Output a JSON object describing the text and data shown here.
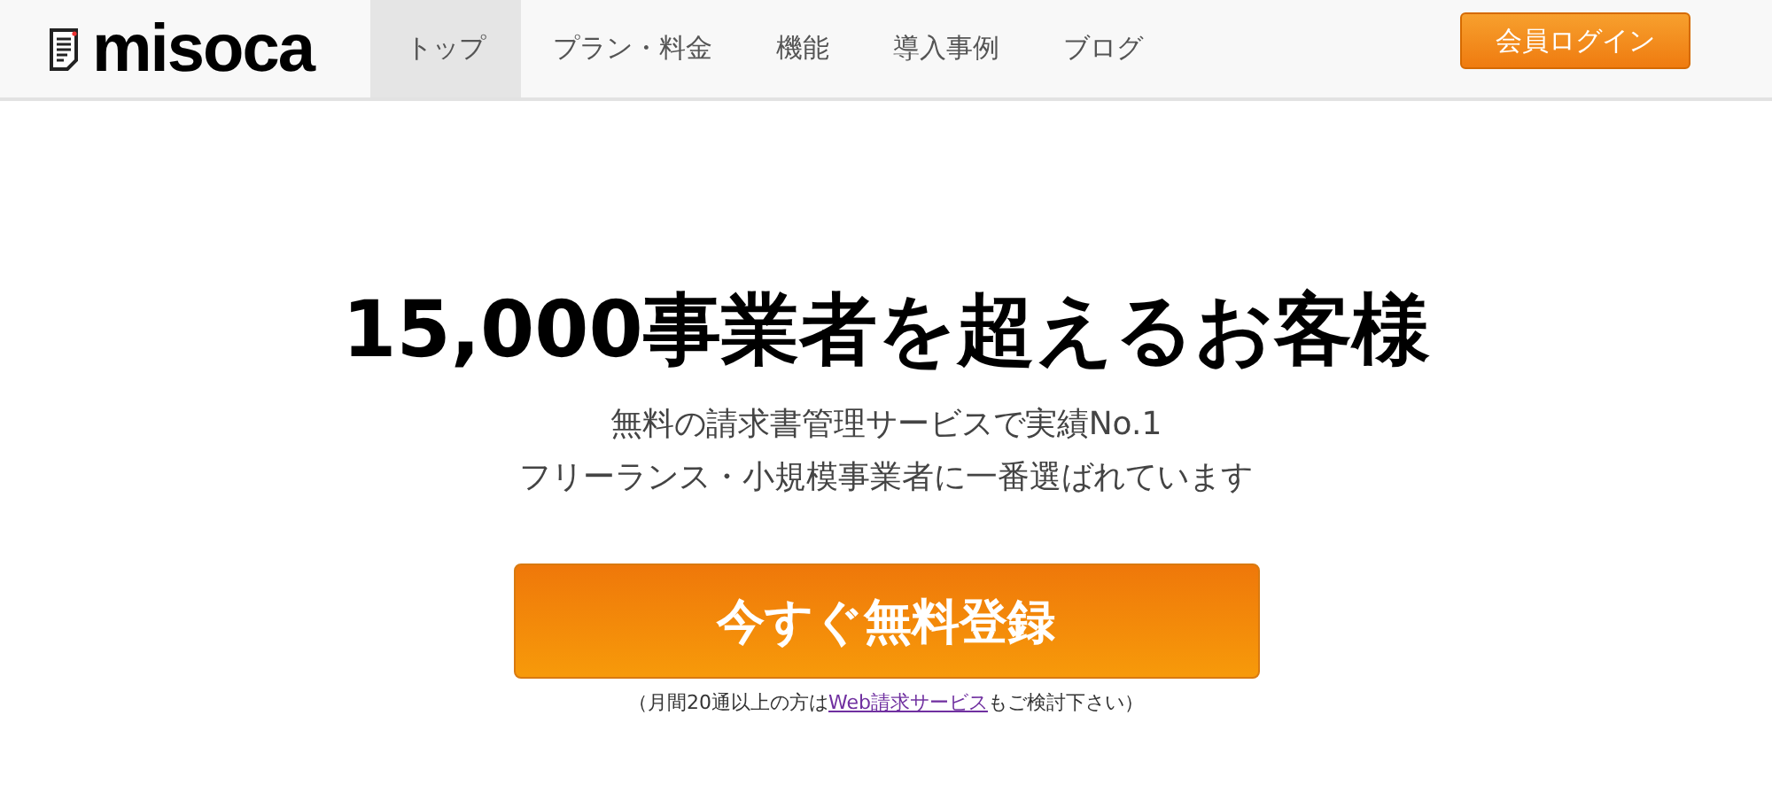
{
  "header": {
    "logo": "misoca",
    "nav": [
      {
        "label": "トップ",
        "selected": true
      },
      {
        "label": "プラン・料金",
        "selected": false
      },
      {
        "label": "機能",
        "selected": false
      },
      {
        "label": "導入事例",
        "selected": false
      },
      {
        "label": "ブログ",
        "selected": false
      }
    ],
    "login_button": "会員ログイン"
  },
  "hero": {
    "headline": "15,000事業者を超えるお客様",
    "subtitle": [
      "無料の請求書管理サービスで実績No.1",
      "フリーランス・小規模事業者に一番選ばれています"
    ],
    "cta_button": "今すぐ無料登録",
    "note": {
      "before": "（月間20通以上の方は",
      "link": "Web請求サービス",
      "after": "もご検討下さい）"
    }
  }
}
